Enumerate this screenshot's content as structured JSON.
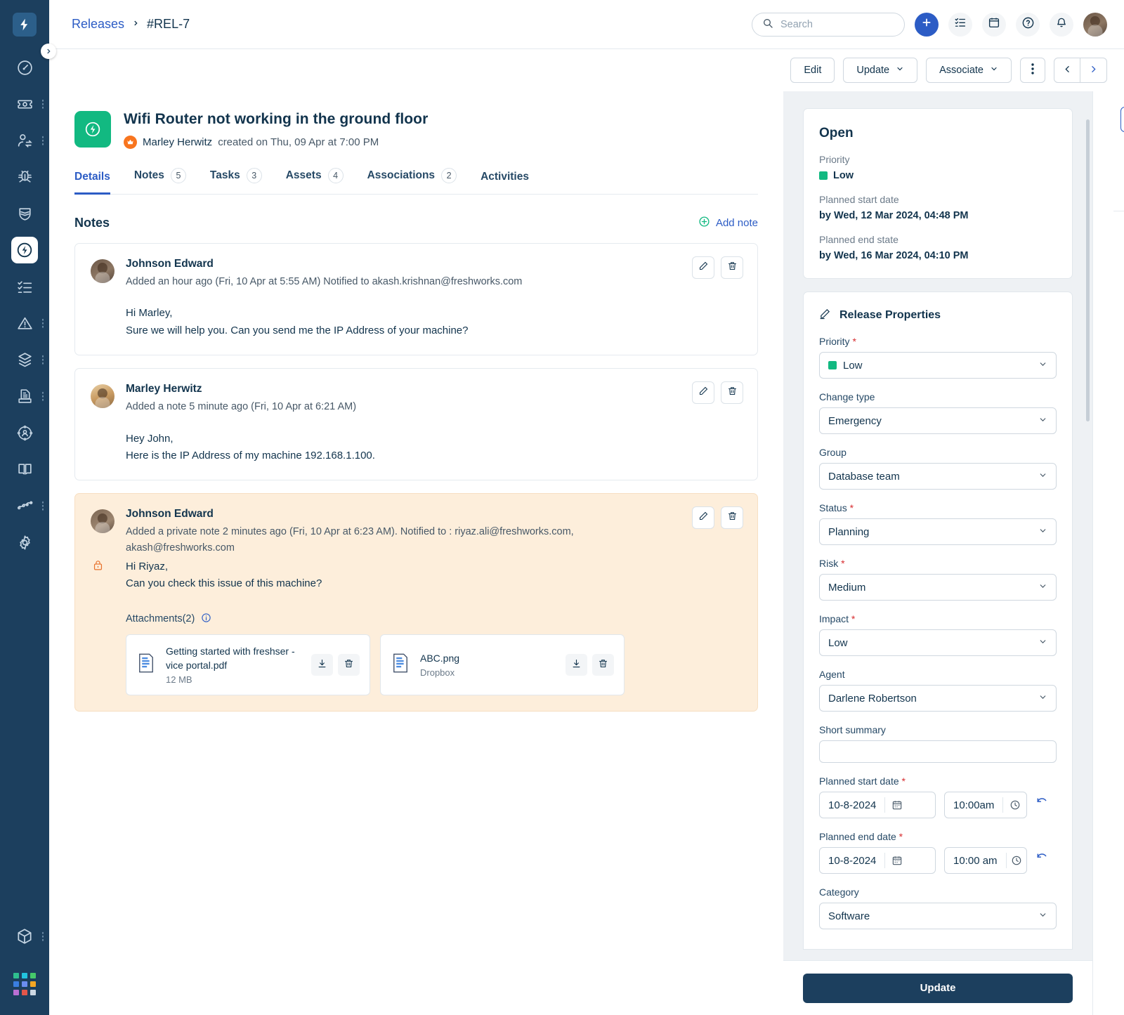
{
  "brand": {
    "accent": "#2c5cc5",
    "sidebar_bg": "#1c3f5e",
    "success": "#12b981",
    "private_bg": "#fdeedb",
    "danger": "#d72d30"
  },
  "sidebar": {
    "logo_icon": "freshservice-bolt-logo",
    "collapse_icon": "chevron-right-icon",
    "items": [
      {
        "name": "dashboard",
        "icon": "gauge-icon",
        "has_dots": false,
        "active": false
      },
      {
        "name": "tickets",
        "icon": "ticket-icon",
        "has_dots": true,
        "active": false
      },
      {
        "name": "service-requests",
        "icon": "user-switch-icon",
        "has_dots": true,
        "active": false
      },
      {
        "name": "problems",
        "icon": "bug-icon",
        "has_dots": false,
        "active": false
      },
      {
        "name": "changes",
        "icon": "shield-icon",
        "has_dots": false,
        "active": false
      },
      {
        "name": "releases",
        "icon": "bolt-circle-icon",
        "has_dots": false,
        "active": true
      },
      {
        "name": "tasks",
        "icon": "checklist-icon",
        "has_dots": false,
        "active": false
      },
      {
        "name": "alerts",
        "icon": "alert-triangle-icon",
        "has_dots": true,
        "active": false
      },
      {
        "name": "assets",
        "icon": "layers-icon",
        "has_dots": true,
        "active": false
      },
      {
        "name": "contracts",
        "icon": "document-inbox-icon",
        "has_dots": true,
        "active": false
      },
      {
        "name": "onboarding",
        "icon": "user-target-icon",
        "has_dots": false,
        "active": false
      },
      {
        "name": "solutions",
        "icon": "book-icon",
        "has_dots": false,
        "active": false
      },
      {
        "name": "analytics",
        "icon": "analytics-icon",
        "has_dots": true,
        "active": false
      },
      {
        "name": "admin",
        "icon": "gear-icon",
        "has_dots": false,
        "active": false
      }
    ],
    "bottom": [
      {
        "name": "marketplace",
        "icon": "cube-icon",
        "has_dots": true
      }
    ],
    "app_switcher": {
      "icon": "app-grid-icon",
      "colors": [
        "#2fbf8f",
        "#22c3de",
        "#45c96a",
        "#3a7ee0",
        "#6b8df0",
        "#f5a623",
        "#b96fd4",
        "#e2564a",
        "#cdd8e3"
      ]
    }
  },
  "topbar": {
    "breadcrumb": {
      "parent": "Releases",
      "separator": "›",
      "current": "#REL-7"
    },
    "search": {
      "placeholder": "Search",
      "value": "",
      "icon": "search-icon"
    },
    "buttons": [
      {
        "name": "create-new",
        "icon": "plus-icon"
      },
      {
        "name": "my-tasks",
        "icon": "checklist-icon"
      },
      {
        "name": "calendar",
        "icon": "calendar-icon"
      },
      {
        "name": "help",
        "icon": "question-circle-icon"
      },
      {
        "name": "notifications",
        "icon": "bell-icon"
      }
    ],
    "avatar": "user-avatar"
  },
  "actionbar": {
    "edit_label": "Edit",
    "update_label": "Update",
    "associate_label": "Associate",
    "more_icon": "kebab-menu-icon",
    "prev_icon": "chevron-left-icon",
    "next_icon": "chevron-right-icon"
  },
  "ticket": {
    "icon": "bolt-circle-icon",
    "title": "Wifi Router not working in the ground floor",
    "author": "Marley Herwitz",
    "created": "created on Thu, 09 Apr at 7:00 PM",
    "crown_icon": "crown-icon"
  },
  "tabs": [
    {
      "label": "Details",
      "count": "",
      "active": true
    },
    {
      "label": "Notes",
      "count": "5",
      "active": false
    },
    {
      "label": "Tasks",
      "count": "3",
      "active": false
    },
    {
      "label": "Assets",
      "count": "4",
      "active": false
    },
    {
      "label": "Associations",
      "count": "2",
      "active": false
    },
    {
      "label": "Activities",
      "count": "",
      "active": false
    }
  ],
  "notes_section": {
    "title": "Notes",
    "add_note_label": "Add note",
    "add_note_icon": "plus-circle-icon",
    "edit_icon": "pencil-icon",
    "delete_icon": "trash-icon",
    "notes": [
      {
        "author": "Johnson Edward",
        "sub": "Added an hour ago (Fri, 10 Apr at 5:55 AM) Notified to akash.krishnan@freshworks.com",
        "body_line1": "Hi Marley,",
        "body_line2": "Sure we will help you. Can you send me the IP Address of your machine?",
        "private": false
      },
      {
        "author": "Marley Herwitz",
        "sub": "Added a note 5 minute ago (Fri, 10 Apr at 6:21 AM)",
        "body_line1": "Hey John,",
        "body_line2": "Here is the IP Address of my machine 192.168.1.100.",
        "private": false
      },
      {
        "author": "Johnson Edward",
        "sub": "Added a private note 2 minutes ago (Fri, 10 Apr at 6:23 AM). Notified to : riyaz.ali@freshworks.com, akash@freshworks.com",
        "body_line1": "Hi Riyaz,",
        "body_line2": "Can you check this issue of this machine?",
        "private": true,
        "lock_icon": "lock-icon",
        "attachments_label": "Attachments(2)",
        "attachments_info_icon": "info-circle-icon",
        "attachments": [
          {
            "name": "Getting started with freshser -vice portal.pdf",
            "meta": "12 MB",
            "icon": "file-doc-icon",
            "download_icon": "download-icon",
            "delete_icon": "trash-icon"
          },
          {
            "name": "ABC.png",
            "meta": "Dropbox",
            "icon": "file-doc-icon",
            "download_icon": "download-icon",
            "delete_icon": "trash-icon"
          }
        ]
      }
    ]
  },
  "status_card": {
    "state": "Open",
    "priority_label": "Priority",
    "priority_value": "Low",
    "priority_color": "#12b981",
    "start_label": "Planned start date",
    "start_value": "by Wed, 12 Mar 2024, 04:48 PM",
    "end_label": "Planned end state",
    "end_value": "by Wed, 16 Mar 2024, 04:10 PM"
  },
  "properties": {
    "title": "Release Properties",
    "title_icon": "pencil-icon",
    "chevron_icon": "chevron-down-icon",
    "calendar_icon": "calendar-picker-icon",
    "clock_icon": "clock-icon",
    "reset_icon": "undo-icon",
    "fields": [
      {
        "label": "Priority",
        "required": true,
        "value": "Low",
        "swatch": "#12b981",
        "type": "select"
      },
      {
        "label": "Change type",
        "required": false,
        "value": "Emergency",
        "type": "select"
      },
      {
        "label": "Group",
        "required": false,
        "value": "Database team",
        "type": "select"
      },
      {
        "label": "Status",
        "required": true,
        "value": "Planning",
        "type": "select"
      },
      {
        "label": "Risk",
        "required": true,
        "value": "Medium",
        "type": "select"
      },
      {
        "label": "Impact",
        "required": true,
        "value": "Low",
        "type": "select"
      },
      {
        "label": "Agent",
        "required": false,
        "value": "Darlene Robertson",
        "type": "select"
      },
      {
        "label": "Short summary",
        "required": false,
        "value": "",
        "type": "text"
      }
    ],
    "planned_start": {
      "label": "Planned start date",
      "required": true,
      "date": "10-8-2024",
      "time": "10:00am"
    },
    "planned_end": {
      "label": "Planned end date",
      "required": true,
      "date": "10-8-2024",
      "time": "10:00 am"
    },
    "category": {
      "label": "Category",
      "required": false,
      "value": "Software"
    }
  },
  "footer": {
    "update_label": "Update"
  },
  "rail": {
    "items": [
      {
        "name": "details-info",
        "icon": "info-circle-icon",
        "active": true
      },
      {
        "name": "edit-note",
        "icon": "pencil-icon",
        "active": false
      },
      {
        "name": "activity-time",
        "icon": "clock-icon",
        "active": false
      },
      {
        "name": "jira-integration",
        "icon": "jira-icon",
        "active": false
      }
    ]
  }
}
